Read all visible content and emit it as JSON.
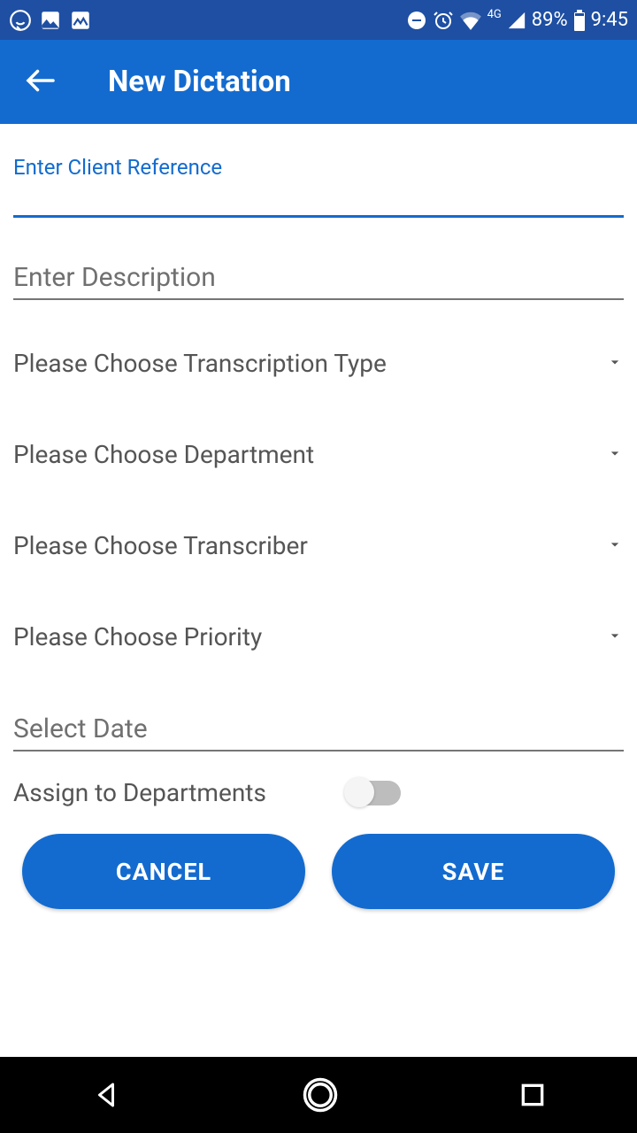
{
  "status": {
    "battery": "89%",
    "time": "9:45",
    "network": "4G"
  },
  "appbar": {
    "title": "New Dictation"
  },
  "form": {
    "client_ref_label": "Enter Client Reference",
    "description_placeholder": "Enter Description",
    "transcription_type": "Please Choose Transcription Type",
    "department": "Please Choose Department",
    "transcriber": "Please Choose Transcriber",
    "priority": "Please Choose Priority",
    "select_date": "Select Date",
    "assign_to_departments": "Assign to Departments"
  },
  "buttons": {
    "cancel": "CANCEL",
    "save": "SAVE"
  }
}
